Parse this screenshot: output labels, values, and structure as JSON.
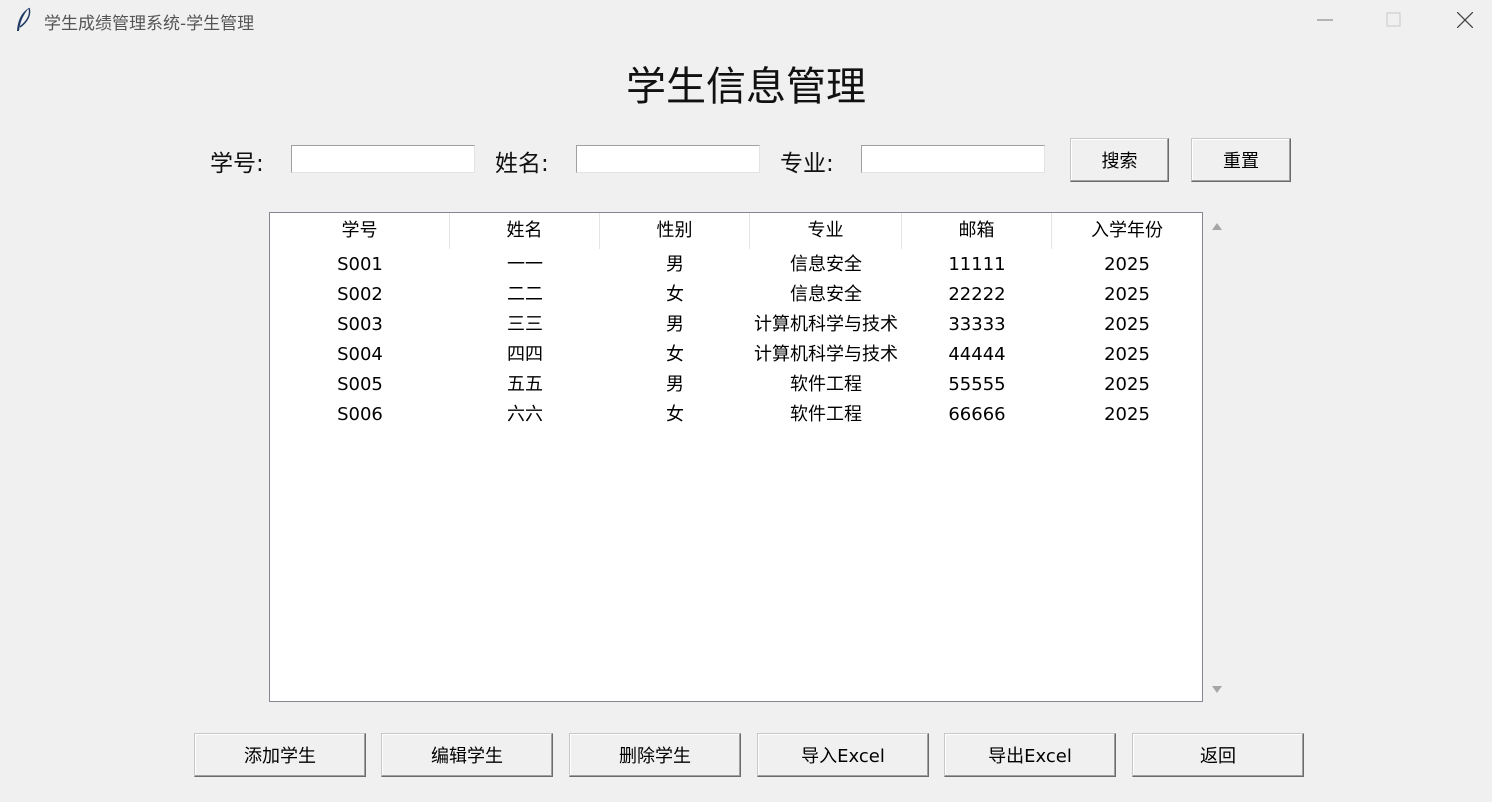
{
  "window": {
    "title": "学生成绩管理系统-学生管理",
    "app_icon": "feather-icon"
  },
  "page": {
    "title": "学生信息管理"
  },
  "search": {
    "student_id_label": "学号:",
    "name_label": "姓名:",
    "major_label": "专业:",
    "student_id_value": "",
    "name_value": "",
    "major_value": "",
    "search_button": "搜索",
    "reset_button": "重置"
  },
  "table": {
    "headers": [
      "学号",
      "姓名",
      "性别",
      "专业",
      "邮箱",
      "入学年份"
    ],
    "rows": [
      [
        "S001",
        "一一",
        "男",
        "信息安全",
        "11111",
        "2025"
      ],
      [
        "S002",
        "二二",
        "女",
        "信息安全",
        "22222",
        "2025"
      ],
      [
        "S003",
        "三三",
        "男",
        "计算机科学与技术",
        "33333",
        "2025"
      ],
      [
        "S004",
        "四四",
        "女",
        "计算机科学与技术",
        "44444",
        "2025"
      ],
      [
        "S005",
        "五五",
        "男",
        "软件工程",
        "55555",
        "2025"
      ],
      [
        "S006",
        "六六",
        "女",
        "软件工程",
        "66666",
        "2025"
      ]
    ]
  },
  "actions": {
    "add": "添加学生",
    "edit": "编辑学生",
    "delete": "删除学生",
    "import": "导入Excel",
    "export": "导出Excel",
    "back": "返回"
  },
  "colors": {
    "window_bg": "#f0f0f0",
    "table_bg": "#ffffff",
    "table_border": "#828790"
  }
}
